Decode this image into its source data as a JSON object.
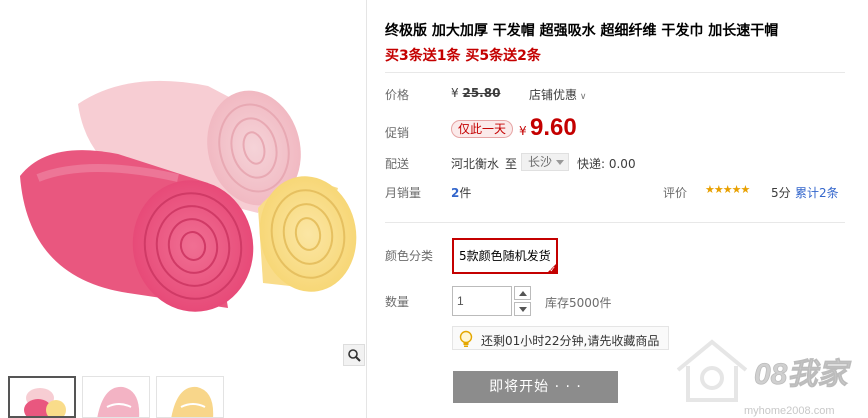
{
  "product": {
    "title": "终极版 加大加厚 干发帽 超强吸水 超细纤维 干发巾 加长速干帽",
    "promo": "买3条送1条 买5条送2条"
  },
  "price": {
    "label": "价格",
    "currency": "¥",
    "original": "25.80",
    "shop_discount": "店铺优惠"
  },
  "promotion": {
    "label": "促销",
    "badge": "仅此一天",
    "currency": "¥",
    "price": "9.60"
  },
  "shipping": {
    "label": "配送",
    "from": "河北衡水",
    "to_label": "至",
    "to_city": "长沙",
    "fee": "快递: 0.00"
  },
  "sales": {
    "label": "月销量",
    "count": "2",
    "unit": "件",
    "rating_label": "评价",
    "stars": "★★★★★",
    "score": "5分",
    "reviews": "累计2条"
  },
  "options": {
    "color_label": "颜色分类",
    "color_value": "5款颜色随机发货"
  },
  "quantity": {
    "label": "数量",
    "value": "1",
    "stock": "库存5000件"
  },
  "reminder": "还剩01小时22分钟,请先收藏商品",
  "buy_button": "即将开始 · · ·",
  "watermark": {
    "brand": "08我家",
    "url": "myhome2008.com"
  },
  "colors": {
    "accent": "#c40000",
    "link": "#3366cc",
    "star": "#e8a000",
    "button_disabled": "#8c8c8c"
  }
}
